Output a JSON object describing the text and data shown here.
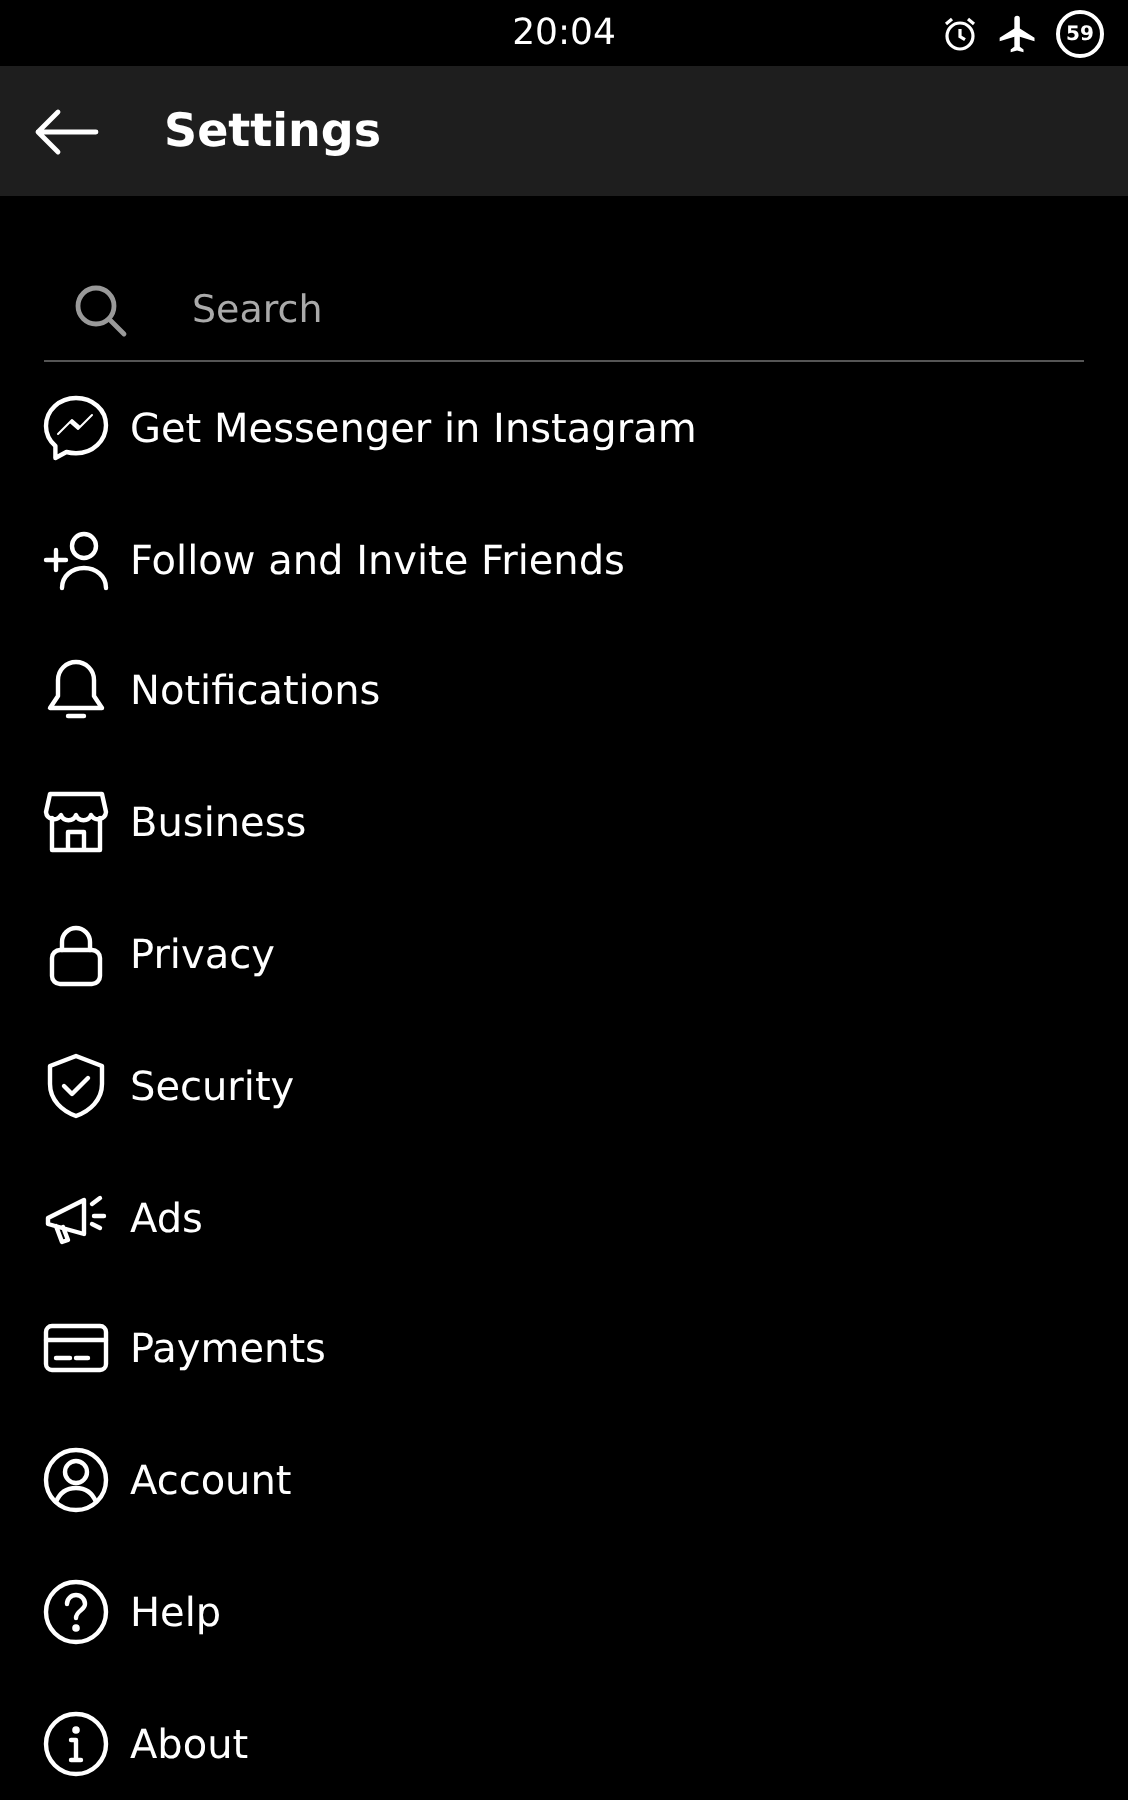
{
  "status_bar": {
    "time": "20:04",
    "battery": "59"
  },
  "header": {
    "title": "Settings"
  },
  "search": {
    "placeholder": "Search"
  },
  "items": [
    {
      "label": "Get Messenger in Instagram",
      "kind": "chat"
    },
    {
      "label": "Follow and Invite Friends",
      "kind": "personadd"
    },
    {
      "label": "Notifications",
      "kind": "bell"
    },
    {
      "label": "Business",
      "kind": "store"
    },
    {
      "label": "Privacy",
      "kind": "lock"
    },
    {
      "label": "Security",
      "kind": "shield"
    },
    {
      "label": "Ads",
      "kind": "megaphone"
    },
    {
      "label": "Payments",
      "kind": "card"
    },
    {
      "label": "Account",
      "kind": "user"
    },
    {
      "label": "Help",
      "kind": "question"
    },
    {
      "label": "About",
      "kind": "info"
    }
  ]
}
